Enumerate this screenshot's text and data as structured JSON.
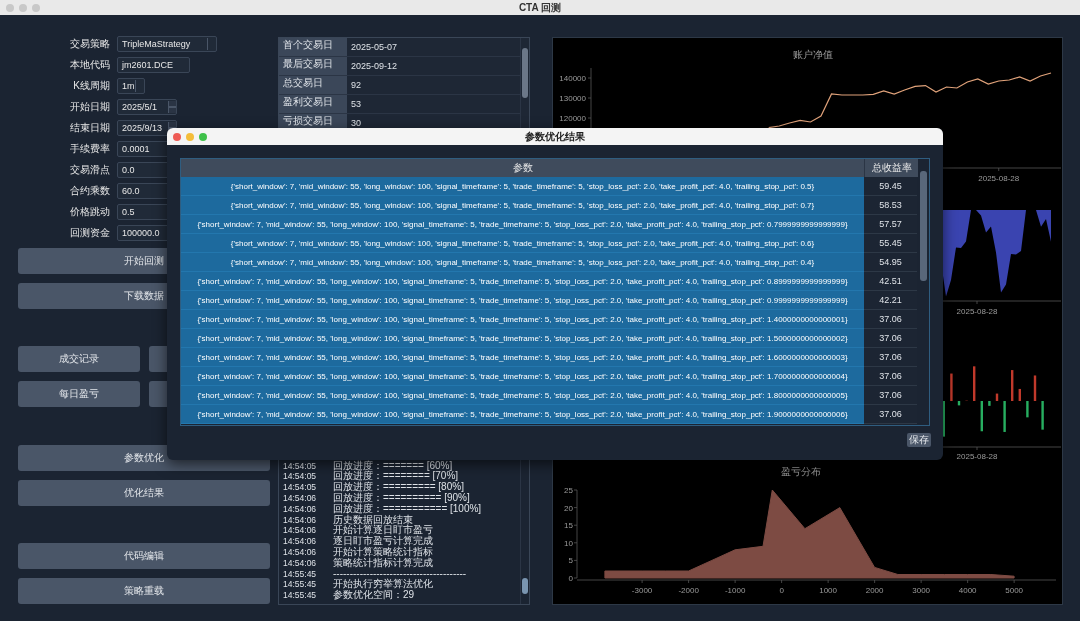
{
  "window": {
    "title": "CTA 回测"
  },
  "form": [
    {
      "label": "交易策略",
      "kind": "select",
      "value": "TripleMaStrategy"
    },
    {
      "label": "本地代码",
      "kind": "text",
      "value": "jm2601.DCE"
    },
    {
      "label": "K线周期",
      "kind": "small-select",
      "value": "1m"
    },
    {
      "label": "开始日期",
      "kind": "date",
      "value": "2025/5/1"
    },
    {
      "label": "结束日期",
      "kind": "date",
      "value": "2025/9/13"
    },
    {
      "label": "手续费率",
      "kind": "wide",
      "value": "0.0001"
    },
    {
      "label": "交易滑点",
      "kind": "wide",
      "value": "0.0"
    },
    {
      "label": "合约乘数",
      "kind": "wide",
      "value": "60.0"
    },
    {
      "label": "价格跳动",
      "kind": "wide",
      "value": "0.5"
    },
    {
      "label": "回测资金",
      "kind": "wide",
      "value": "100000.0"
    }
  ],
  "run_buttons": [
    "开始回测",
    "下载数据"
  ],
  "record_buttons": [
    "成交记录",
    "每日盈亏"
  ],
  "optimize_buttons": [
    "参数优化",
    "优化结果"
  ],
  "tool_buttons": [
    "代码编辑",
    "策略重载"
  ],
  "statistics": [
    {
      "label": "首个交易日",
      "value": "2025-05-07"
    },
    {
      "label": "最后交易日",
      "value": "2025-09-12"
    },
    {
      "label": "总交易日",
      "value": "92"
    },
    {
      "label": "盈利交易日",
      "value": "53"
    },
    {
      "label": "亏损交易日",
      "value": "30"
    }
  ],
  "log": [
    {
      "time": "14:54:05",
      "message": "回放进度：======= [60%]"
    },
    {
      "time": "14:54:05",
      "message": "回放进度：======== [70%]"
    },
    {
      "time": "14:54:05",
      "message": "回放进度：========= [80%]"
    },
    {
      "time": "14:54:06",
      "message": "回放进度：========== [90%]"
    },
    {
      "time": "14:54:06",
      "message": "回放进度：=========== [100%]"
    },
    {
      "time": "14:54:06",
      "message": "历史数据回放结束"
    },
    {
      "time": "14:54:06",
      "message": "开始计算逐日盯市盈亏"
    },
    {
      "time": "14:54:06",
      "message": "逐日盯市盈亏计算完成"
    },
    {
      "time": "14:54:06",
      "message": "开始计算策略统计指标"
    },
    {
      "time": "14:54:06",
      "message": "策略统计指标计算完成"
    },
    {
      "time": "14:55:45",
      "message": "----------------------------------------"
    },
    {
      "time": "14:55:45",
      "message": "开始执行穷举算法优化"
    },
    {
      "time": "14:55:45",
      "message": "参数优化空间：29"
    }
  ],
  "equity_chart": {
    "x_tick_label": "2025-08-28",
    "chart_data": {
      "type": "line",
      "title": "账户净值",
      "ylim": [
        95000,
        145000
      ],
      "yticks": [
        120000,
        130000,
        140000
      ],
      "series": [
        {
          "color": "#e0a27a",
          "values": [
            null,
            null,
            null,
            null,
            null,
            null,
            null,
            null,
            null,
            null,
            null,
            null,
            null,
            null,
            null,
            null,
            null,
            115200,
            116000,
            117500,
            118800,
            118000,
            121000,
            132000,
            131500,
            131500,
            131500,
            131800,
            133500,
            132000,
            134000,
            135800,
            136200,
            133000,
            135500,
            135000,
            138000,
            139500,
            137000,
            138500,
            139000,
            140500,
            138500,
            141000,
            142500
          ]
        }
      ]
    }
  },
  "drawdown_chart": {
    "x_tick_label": "2025-08-28"
  },
  "pnl_chart": {
    "x_tick_label": "2025-08-28"
  },
  "distribution_chart": {
    "chart_data": {
      "type": "area",
      "title": "盈亏分布",
      "xlim": [
        -4400,
        5900
      ],
      "ylim": [
        0,
        25
      ],
      "xticks": [
        -3000,
        -2000,
        -1000,
        0,
        1000,
        2000,
        3000,
        4000,
        5000
      ],
      "yticks": [
        0,
        5,
        10,
        15,
        20,
        25
      ],
      "x": [
        -3800,
        -3000,
        -2500,
        -2000,
        -1500,
        -1000,
        -400,
        -200,
        500,
        1250,
        2000,
        2500,
        3000,
        3500,
        4000,
        4500,
        5000
      ],
      "series": [
        {
          "color": "#7d4b43",
          "values": [
            2,
            2,
            2,
            2,
            5,
            8,
            9,
            25,
            14,
            20,
            3,
            1,
            1,
            1,
            1,
            1,
            0.5
          ]
        }
      ]
    }
  },
  "dialog": {
    "title": "参数优化结果",
    "columns": [
      "参数",
      "总收益率"
    ],
    "rows": [
      {
        "params": "{'short_window': 7, 'mid_window': 55, 'long_window': 100, 'signal_timeframe': 5, 'trade_timeframe': 5, 'stop_loss_pct': 2.0, 'take_profit_pct': 4.0, 'trailing_stop_pct': 0.5}",
        "return": "59.45"
      },
      {
        "params": "{'short_window': 7, 'mid_window': 55, 'long_window': 100, 'signal_timeframe': 5, 'trade_timeframe': 5, 'stop_loss_pct': 2.0, 'take_profit_pct': 4.0, 'trailing_stop_pct': 0.7}",
        "return": "58.53"
      },
      {
        "params": "{'short_window': 7, 'mid_window': 55, 'long_window': 100, 'signal_timeframe': 5, 'trade_timeframe': 5, 'stop_loss_pct': 2.0, 'take_profit_pct': 4.0, 'trailing_stop_pct': 0.7999999999999999}",
        "return": "57.57"
      },
      {
        "params": "{'short_window': 7, 'mid_window': 55, 'long_window': 100, 'signal_timeframe': 5, 'trade_timeframe': 5, 'stop_loss_pct': 2.0, 'take_profit_pct': 4.0, 'trailing_stop_pct': 0.6}",
        "return": "55.45"
      },
      {
        "params": "{'short_window': 7, 'mid_window': 55, 'long_window': 100, 'signal_timeframe': 5, 'trade_timeframe': 5, 'stop_loss_pct': 2.0, 'take_profit_pct': 4.0, 'trailing_stop_pct': 0.4}",
        "return": "54.95"
      },
      {
        "params": "{'short_window': 7, 'mid_window': 55, 'long_window': 100, 'signal_timeframe': 5, 'trade_timeframe': 5, 'stop_loss_pct': 2.0, 'take_profit_pct': 4.0, 'trailing_stop_pct': 0.8999999999999999}",
        "return": "42.51"
      },
      {
        "params": "{'short_window': 7, 'mid_window': 55, 'long_window': 100, 'signal_timeframe': 5, 'trade_timeframe': 5, 'stop_loss_pct': 2.0, 'take_profit_pct': 4.0, 'trailing_stop_pct': 0.9999999999999999}",
        "return": "42.21"
      },
      {
        "params": "{'short_window': 7, 'mid_window': 55, 'long_window': 100, 'signal_timeframe': 5, 'trade_timeframe': 5, 'stop_loss_pct': 2.0, 'take_profit_pct': 4.0, 'trailing_stop_pct': 1.4000000000000001}",
        "return": "37.06"
      },
      {
        "params": "{'short_window': 7, 'mid_window': 55, 'long_window': 100, 'signal_timeframe': 5, 'trade_timeframe': 5, 'stop_loss_pct': 2.0, 'take_profit_pct': 4.0, 'trailing_stop_pct': 1.5000000000000002}",
        "return": "37.06"
      },
      {
        "params": "{'short_window': 7, 'mid_window': 55, 'long_window': 100, 'signal_timeframe': 5, 'trade_timeframe': 5, 'stop_loss_pct': 2.0, 'take_profit_pct': 4.0, 'trailing_stop_pct': 1.6000000000000003}",
        "return": "37.06"
      },
      {
        "params": "{'short_window': 7, 'mid_window': 55, 'long_window': 100, 'signal_timeframe': 5, 'trade_timeframe': 5, 'stop_loss_pct': 2.0, 'take_profit_pct': 4.0, 'trailing_stop_pct': 1.7000000000000004}",
        "return": "37.06"
      },
      {
        "params": "{'short_window': 7, 'mid_window': 55, 'long_window': 100, 'signal_timeframe': 5, 'trade_timeframe': 5, 'stop_loss_pct': 2.0, 'take_profit_pct': 4.0, 'trailing_stop_pct': 1.8000000000000005}",
        "return": "37.06"
      },
      {
        "params": "{'short_window': 7, 'mid_window': 55, 'long_window': 100, 'signal_timeframe': 5, 'trade_timeframe': 5, 'stop_loss_pct': 2.0, 'take_profit_pct': 4.0, 'trailing_stop_pct': 1.9000000000000006}",
        "return": "37.06"
      }
    ],
    "save_button": "保存"
  }
}
